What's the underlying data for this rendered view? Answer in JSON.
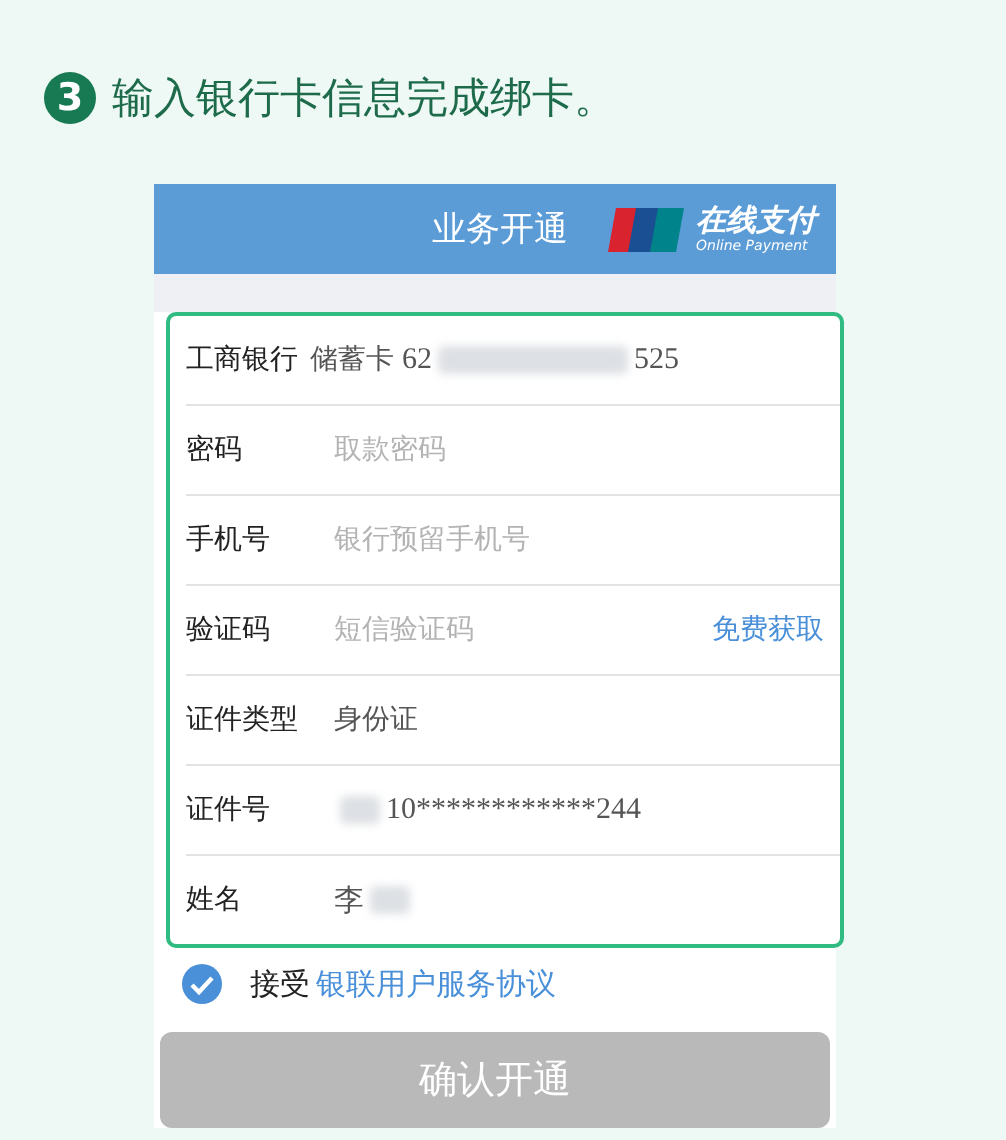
{
  "step": {
    "number": "3",
    "text": "输入银行卡信息完成绑卡。"
  },
  "header": {
    "title": "业务开通",
    "brand": "在线支付",
    "brand_sub": "Online Payment"
  },
  "form": {
    "rows": [
      {
        "kind": "card",
        "label": "工商银行",
        "type": "储蓄卡",
        "prefix": "62",
        "suffix": "525"
      },
      {
        "kind": "input",
        "label": "密码",
        "placeholder": "取款密码"
      },
      {
        "kind": "input",
        "label": "手机号",
        "placeholder": "银行预留手机号"
      },
      {
        "kind": "input",
        "label": "验证码",
        "placeholder": "短信验证码",
        "action": "免费获取"
      },
      {
        "kind": "value",
        "label": "证件类型",
        "value": "身份证"
      },
      {
        "kind": "masked",
        "label": "证件号",
        "value": "10************244",
        "masked_before": true
      },
      {
        "kind": "masked",
        "label": "姓名",
        "value": "李",
        "masked_after": true
      }
    ]
  },
  "agreement": {
    "checked": true,
    "text": "接受",
    "link": "银联用户服务协议"
  },
  "confirm_button": {
    "label": "确认开通",
    "disabled": true
  }
}
